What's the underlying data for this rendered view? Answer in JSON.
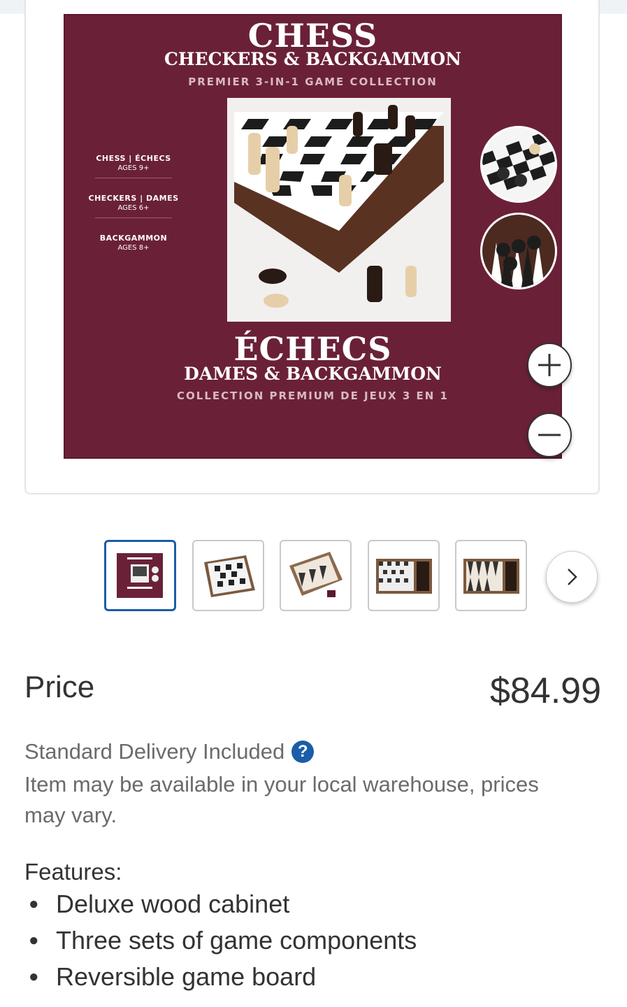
{
  "product_image": {
    "box_title_en": "CHESS",
    "box_subtitle_en": "CHECKERS & BACKGAMMON",
    "box_tagline_en": "PREMIER 3-IN-1 GAME COLLECTION",
    "box_title_fr": "ÉCHECS",
    "box_subtitle_fr": "DAMES & BACKGAMMON",
    "box_tagline_fr": "COLLECTION PREMIUM DE JEUX 3 EN 1",
    "games": [
      {
        "name": "CHESS | ÉCHECS",
        "age": "AGES 9+"
      },
      {
        "name": "CHECKERS | DAMES",
        "age": "AGES 6+"
      },
      {
        "name": "BACKGAMMON",
        "age": "AGES 8+"
      }
    ]
  },
  "zoom": {
    "in_icon": "plus-icon",
    "out_icon": "minus-icon"
  },
  "thumbnails": [
    {
      "icon": "box-front-thumbnail",
      "selected": true
    },
    {
      "icon": "chessboard-thumbnail",
      "selected": false
    },
    {
      "icon": "backgammon-thumbnail",
      "selected": false
    },
    {
      "icon": "open-case-chess-thumbnail",
      "selected": false
    },
    {
      "icon": "open-case-backgammon-thumbnail",
      "selected": false
    }
  ],
  "price": {
    "label": "Price",
    "value": "$84.99"
  },
  "delivery": {
    "text": "Standard Delivery Included",
    "help_icon": "?",
    "note": "Item may be available in your local warehouse, prices may vary."
  },
  "features": {
    "title": "Features:",
    "items": [
      "Deluxe wood cabinet",
      "Three sets of game components",
      "Reversible game board"
    ]
  },
  "colors": {
    "accent": "#1b5da8",
    "box": "#6a2138",
    "text": "#333333",
    "muted": "#6b6b6b"
  }
}
